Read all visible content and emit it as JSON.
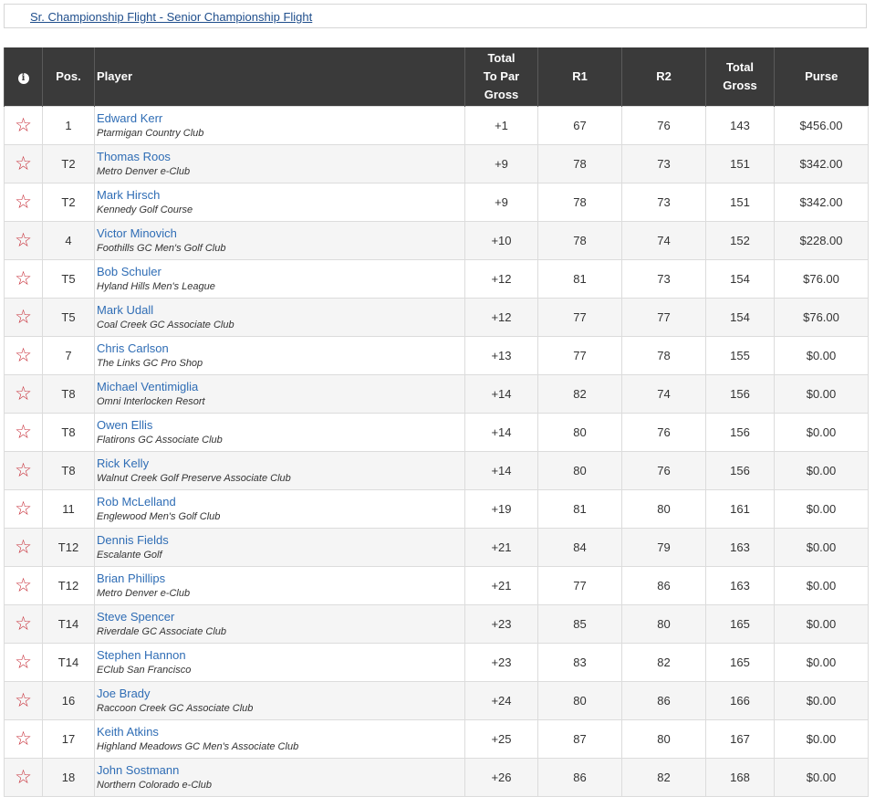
{
  "flight": {
    "label": "Sr. Championship Flight - Senior Championship Flight"
  },
  "header": {
    "info_icon": "i",
    "pos": "Pos.",
    "player": "Player",
    "total_to_par": [
      "Total",
      "To Par",
      "Gross"
    ],
    "r1": "R1",
    "r2": "R2",
    "total_gross": [
      "Total",
      "Gross"
    ],
    "purse": "Purse"
  },
  "icons": {
    "favorite": "star-outline-icon",
    "info": "info-icon"
  },
  "colors": {
    "header_bg": "#3a3a3a",
    "link": "#2f6db5",
    "star": "#c8323c"
  },
  "rows": [
    {
      "pos": "1",
      "name": "Edward Kerr",
      "club": "Ptarmigan Country Club",
      "to_par": "+1",
      "r1": "67",
      "r2": "76",
      "total": "143",
      "purse": "$456.00"
    },
    {
      "pos": "T2",
      "name": "Thomas Roos",
      "club": "Metro Denver e-Club",
      "to_par": "+9",
      "r1": "78",
      "r2": "73",
      "total": "151",
      "purse": "$342.00"
    },
    {
      "pos": "T2",
      "name": "Mark Hirsch",
      "club": "Kennedy Golf Course",
      "to_par": "+9",
      "r1": "78",
      "r2": "73",
      "total": "151",
      "purse": "$342.00"
    },
    {
      "pos": "4",
      "name": "Victor Minovich",
      "club": "Foothills GC Men's Golf Club",
      "to_par": "+10",
      "r1": "78",
      "r2": "74",
      "total": "152",
      "purse": "$228.00"
    },
    {
      "pos": "T5",
      "name": "Bob Schuler",
      "club": "Hyland Hills Men's League",
      "to_par": "+12",
      "r1": "81",
      "r2": "73",
      "total": "154",
      "purse": "$76.00"
    },
    {
      "pos": "T5",
      "name": "Mark Udall",
      "club": "Coal Creek GC Associate Club",
      "to_par": "+12",
      "r1": "77",
      "r2": "77",
      "total": "154",
      "purse": "$76.00"
    },
    {
      "pos": "7",
      "name": "Chris Carlson",
      "club": "The Links GC Pro Shop",
      "to_par": "+13",
      "r1": "77",
      "r2": "78",
      "total": "155",
      "purse": "$0.00"
    },
    {
      "pos": "T8",
      "name": "Michael Ventimiglia",
      "club": "Omni Interlocken Resort",
      "to_par": "+14",
      "r1": "82",
      "r2": "74",
      "total": "156",
      "purse": "$0.00"
    },
    {
      "pos": "T8",
      "name": "Owen Ellis",
      "club": "Flatirons GC Associate Club",
      "to_par": "+14",
      "r1": "80",
      "r2": "76",
      "total": "156",
      "purse": "$0.00"
    },
    {
      "pos": "T8",
      "name": "Rick Kelly",
      "club": "Walnut Creek Golf Preserve Associate Club",
      "to_par": "+14",
      "r1": "80",
      "r2": "76",
      "total": "156",
      "purse": "$0.00"
    },
    {
      "pos": "11",
      "name": "Rob McLelland",
      "club": "Englewood Men's Golf Club",
      "to_par": "+19",
      "r1": "81",
      "r2": "80",
      "total": "161",
      "purse": "$0.00"
    },
    {
      "pos": "T12",
      "name": "Dennis Fields",
      "club": "Escalante Golf",
      "to_par": "+21",
      "r1": "84",
      "r2": "79",
      "total": "163",
      "purse": "$0.00"
    },
    {
      "pos": "T12",
      "name": "Brian Phillips",
      "club": "Metro Denver e-Club",
      "to_par": "+21",
      "r1": "77",
      "r2": "86",
      "total": "163",
      "purse": "$0.00"
    },
    {
      "pos": "T14",
      "name": "Steve Spencer",
      "club": "Riverdale GC Associate Club",
      "to_par": "+23",
      "r1": "85",
      "r2": "80",
      "total": "165",
      "purse": "$0.00"
    },
    {
      "pos": "T14",
      "name": "Stephen Hannon",
      "club": "EClub San Francisco",
      "to_par": "+23",
      "r1": "83",
      "r2": "82",
      "total": "165",
      "purse": "$0.00"
    },
    {
      "pos": "16",
      "name": "Joe Brady",
      "club": "Raccoon Creek GC Associate Club",
      "to_par": "+24",
      "r1": "80",
      "r2": "86",
      "total": "166",
      "purse": "$0.00"
    },
    {
      "pos": "17",
      "name": "Keith Atkins",
      "club": "Highland Meadows GC Men's Associate Club",
      "to_par": "+25",
      "r1": "87",
      "r2": "80",
      "total": "167",
      "purse": "$0.00"
    },
    {
      "pos": "18",
      "name": "John Sostmann",
      "club": "Northern Colorado e-Club",
      "to_par": "+26",
      "r1": "86",
      "r2": "82",
      "total": "168",
      "purse": "$0.00"
    }
  ]
}
